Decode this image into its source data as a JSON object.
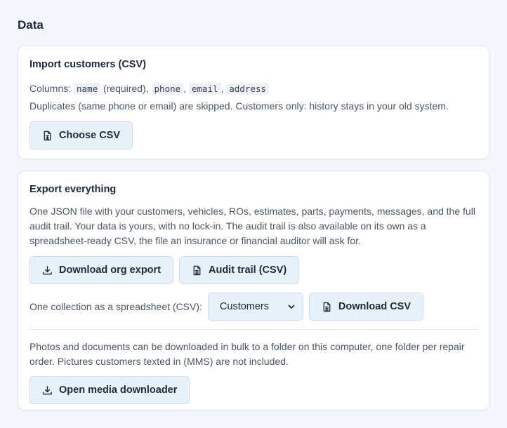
{
  "page": {
    "title": "Data"
  },
  "import": {
    "title": "Import customers (CSV)",
    "columns_prefix": "Columns:",
    "col_name": "name",
    "col_name_suffix": "(required),",
    "col_phone": "phone",
    "col_email": "email",
    "col_address": "address",
    "sep": ",",
    "description": "Duplicates (same phone or email) are skipped. Customers only: history stays in your old system.",
    "button_label": "Choose CSV",
    "button_icon": "file-spreadsheet-icon"
  },
  "export": {
    "title": "Export everything",
    "description": "One JSON file with your customers, vehicles, ROs, estimates, parts, payments, messages, and the full audit trail. Your data is yours, with no lock-in. The audit trail is also available on its own as a spreadsheet-ready CSV, the file an insurance or financial auditor will ask for.",
    "download_org_label": "Download org export",
    "download_org_icon": "download-icon",
    "audit_trail_label": "Audit trail (CSV)",
    "audit_trail_icon": "file-spreadsheet-icon",
    "collection_label": "One collection as a spreadsheet (CSV):",
    "collection_selected": "Customers",
    "download_csv_label": "Download CSV",
    "download_csv_icon": "file-spreadsheet-icon",
    "media_description": "Photos and documents can be downloaded in bulk to a folder on this computer, one folder per repair order. Pictures customers texted in (MMS) are not included.",
    "media_button_label": "Open media downloader",
    "media_button_icon": "download-icon"
  }
}
